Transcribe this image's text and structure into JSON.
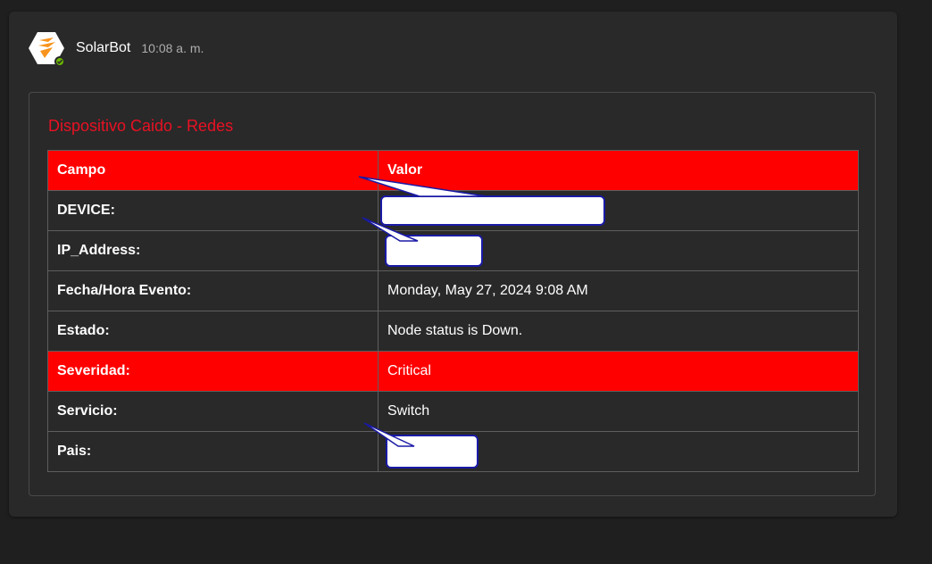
{
  "message": {
    "sender": "SolarBot",
    "time": "10:08 a. m.",
    "avatar_icon": "solarwinds-logo-icon",
    "presence": "available"
  },
  "card": {
    "title": "Dispositivo Caido - Redes",
    "title_color": "#e81123",
    "header": {
      "campo": "Campo",
      "valor": "Valor"
    },
    "rows": [
      {
        "campo": "DEVICE:",
        "valor": "",
        "redacted": true
      },
      {
        "campo": "IP_Address:",
        "valor": "",
        "redacted": true
      },
      {
        "campo": "Fecha/Hora Evento:",
        "valor": "Monday, May 27, 2024 9:08 AM"
      },
      {
        "campo": "Estado:",
        "valor": "Node status is Down."
      },
      {
        "campo": "Severidad:",
        "valor": "Critical",
        "highlight": "#ff0000"
      },
      {
        "campo": "Servicio:",
        "valor": "Switch"
      },
      {
        "campo": "Pais:",
        "valor": "",
        "redacted": true
      }
    ]
  },
  "colors": {
    "background": "#1f1f1f",
    "card": "#292929",
    "highlight_row": "#ff0000",
    "redaction_border": "#1a1aa6"
  }
}
